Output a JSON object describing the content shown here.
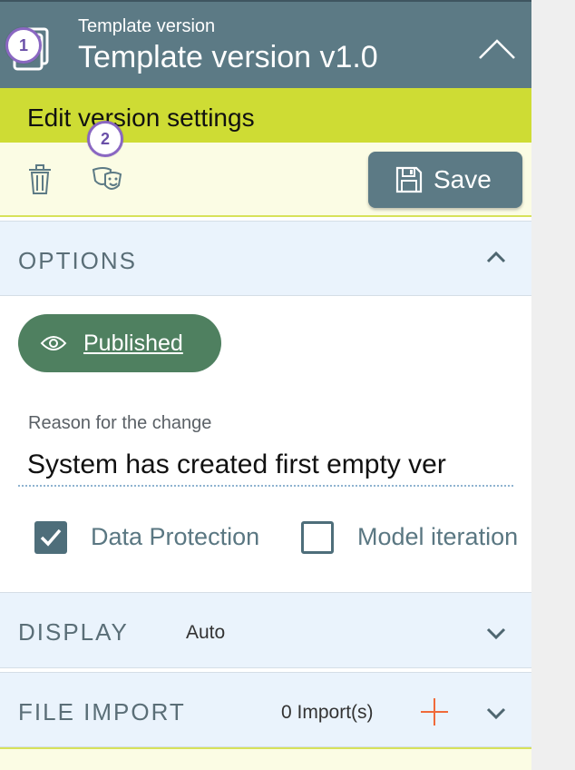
{
  "header": {
    "subtitle": "Template version",
    "title": "Template version v1.0"
  },
  "badges": [
    "1",
    "2"
  ],
  "edit_bar": {
    "title": "Edit version settings",
    "save_label": "Save"
  },
  "options": {
    "label": "OPTIONS",
    "status_label": "Published",
    "reason_label": "Reason for the change",
    "reason_value": "System has created first empty ver",
    "checkboxes": [
      {
        "label": "Data Protection",
        "checked": true
      },
      {
        "label": "Model iteration",
        "checked": false
      }
    ]
  },
  "display": {
    "label": "DISPLAY",
    "value": "Auto"
  },
  "file_import": {
    "label": "FILE IMPORT",
    "count": "0 Import(s)"
  },
  "colors": {
    "header": "#5c7a85",
    "accent_lime": "#cedc34",
    "published": "#4f8060",
    "add_icon": "#f06a3a"
  },
  "icons": [
    "documents-icon",
    "chevron-up-icon",
    "trash-icon",
    "theater-masks-icon",
    "floppy-disk-icon",
    "eye-icon",
    "checkmark-icon",
    "chevron-down-icon",
    "plus-icon"
  ]
}
